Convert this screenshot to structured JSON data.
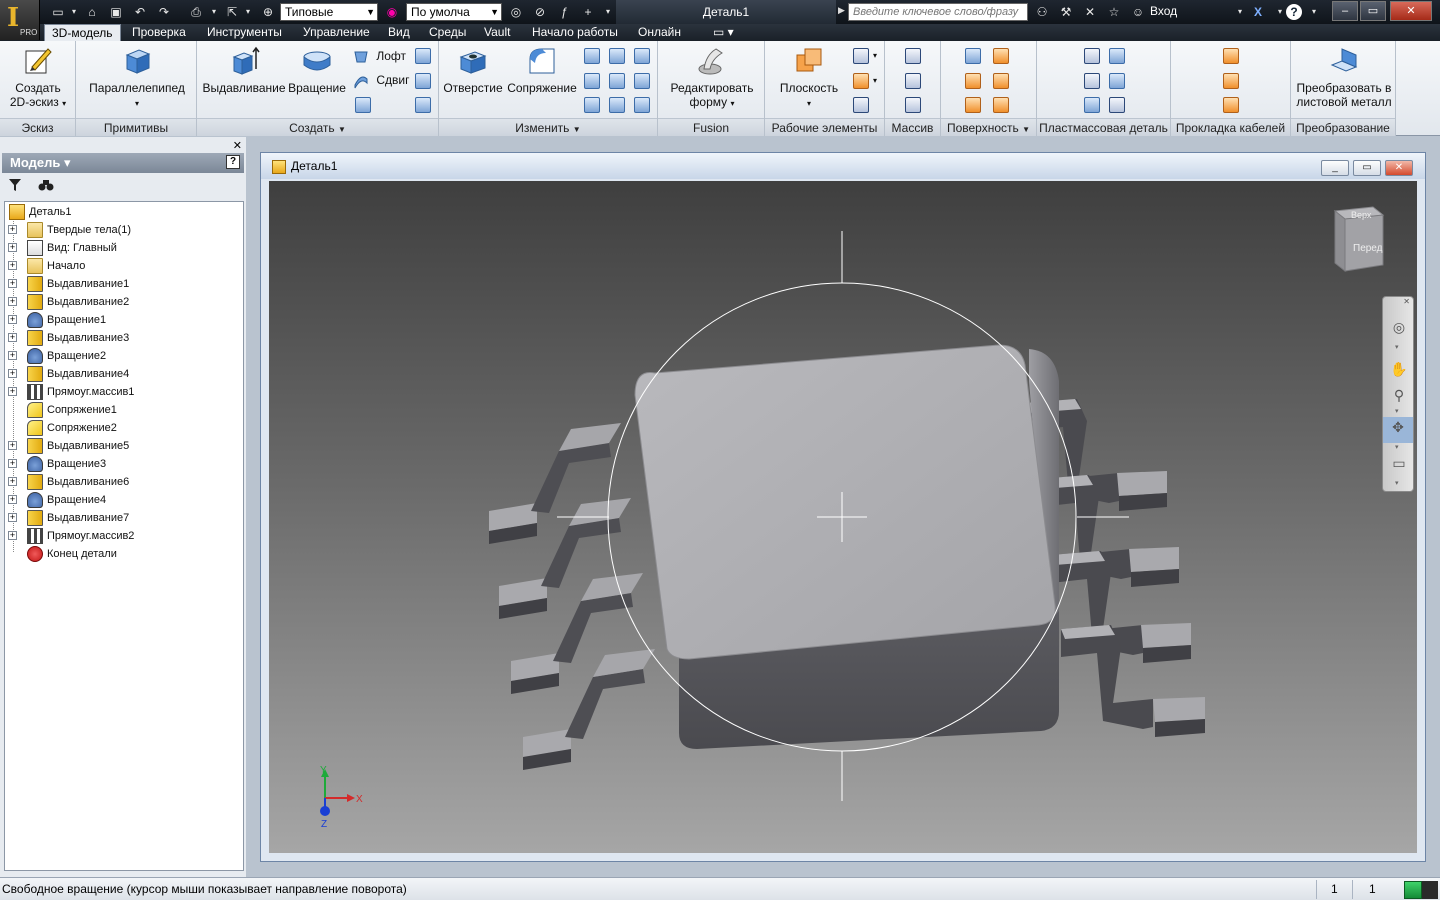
{
  "titlebar": {
    "app_logo_letter": "I",
    "app_logo_badge": "PRO",
    "appearance_select": "Типовые",
    "material_select": "По умолча",
    "document_title": "Деталь1",
    "search_placeholder": "Введите ключевое слово/фразу",
    "signin_label": "Вход",
    "help_label": "?",
    "minimize_label": "‒",
    "maximize_label": "▭",
    "close_label": "✕"
  },
  "menu": {
    "tabs": [
      {
        "label": "3D-модель",
        "active": true
      },
      {
        "label": "Проверка"
      },
      {
        "label": "Инструменты"
      },
      {
        "label": "Управление"
      },
      {
        "label": "Вид"
      },
      {
        "label": "Среды"
      },
      {
        "label": "Vault"
      },
      {
        "label": "Начало работы"
      },
      {
        "label": "Онлайн"
      }
    ]
  },
  "ribbon": {
    "panels": {
      "sketch": {
        "label": "Эскиз",
        "create_2d_line1": "Создать",
        "create_2d_line2": "2D-эскиз"
      },
      "primitives": {
        "label": "Примитивы",
        "box": "Параллелепипед"
      },
      "create": {
        "label": "Создать",
        "extrude": "Выдавливание",
        "revolve": "Вращение",
        "loft": "Лофт",
        "sweep": "Сдвиг"
      },
      "modify": {
        "label": "Изменить",
        "hole": "Отверстие",
        "fillet": "Сопряжение"
      },
      "fusion": {
        "label": "Fusion",
        "edit_form_line1": "Редактировать",
        "edit_form_line2": "форму"
      },
      "work_features": {
        "label": "Рабочие элементы",
        "plane": "Плоскость"
      },
      "pattern": {
        "label": "Массив"
      },
      "surface": {
        "label": "Поверхность"
      },
      "plastic_part": {
        "label": "Пластмассовая деталь"
      },
      "cable_routing": {
        "label": "Прокладка кабелей"
      },
      "convert": {
        "label": "Преобразование",
        "sheet_metal_line1": "Преобразовать в",
        "sheet_metal_line2": "листовой металл"
      }
    }
  },
  "browser": {
    "header": "Модель ▾",
    "help": "?",
    "close": "✕",
    "items": [
      {
        "label": "Деталь1",
        "icon": "part-icon",
        "root": true
      },
      {
        "label": "Твердые тела(1)",
        "icon": "folder-icon",
        "expandable": true
      },
      {
        "label": "Вид: Главный",
        "icon": "view-icon",
        "expandable": true
      },
      {
        "label": "Начало",
        "icon": "folder-icon",
        "expandable": true
      },
      {
        "label": "Выдавливание1",
        "icon": "extrude-icon",
        "expandable": true
      },
      {
        "label": "Выдавливание2",
        "icon": "extrude-icon",
        "expandable": true
      },
      {
        "label": "Вращение1",
        "icon": "revolve-icon",
        "expandable": true
      },
      {
        "label": "Выдавливание3",
        "icon": "extrude-icon",
        "expandable": true
      },
      {
        "label": "Вращение2",
        "icon": "revolve-icon",
        "expandable": true
      },
      {
        "label": "Выдавливание4",
        "icon": "extrude-icon",
        "expandable": true
      },
      {
        "label": "Прямоуг.массив1",
        "icon": "pattern-icon",
        "expandable": true
      },
      {
        "label": "Сопряжение1",
        "icon": "fillet-icon",
        "expandable": false
      },
      {
        "label": "Сопряжение2",
        "icon": "fillet-icon",
        "expandable": false
      },
      {
        "label": "Выдавливание5",
        "icon": "extrude-icon",
        "expandable": true
      },
      {
        "label": "Вращение3",
        "icon": "revolve-icon",
        "expandable": true
      },
      {
        "label": "Выдавливание6",
        "icon": "extrude-icon",
        "expandable": true
      },
      {
        "label": "Вращение4",
        "icon": "revolve-icon",
        "expandable": true
      },
      {
        "label": "Выдавливание7",
        "icon": "extrude-icon",
        "expandable": true
      },
      {
        "label": "Прямоуг.массив2",
        "icon": "pattern-icon",
        "expandable": true
      },
      {
        "label": "Конец детали",
        "icon": "end-of-part-icon",
        "expandable": false
      }
    ]
  },
  "document": {
    "title": "Деталь1",
    "viewcube": {
      "top": "Верх",
      "front": "Перед"
    },
    "triad": {
      "x": "X",
      "y": "Y",
      "z": "Z"
    }
  },
  "status": {
    "text": "Свободное вращение (курсор мыши показывает направление поворота)",
    "count1": "1",
    "count2": "1"
  },
  "colors": {
    "ribbon_bg": "#e8ecf1",
    "titlebar_bg": "#1a2028",
    "viewport_top": "#3f3f3f",
    "viewport_bottom": "#a6a6a6"
  }
}
